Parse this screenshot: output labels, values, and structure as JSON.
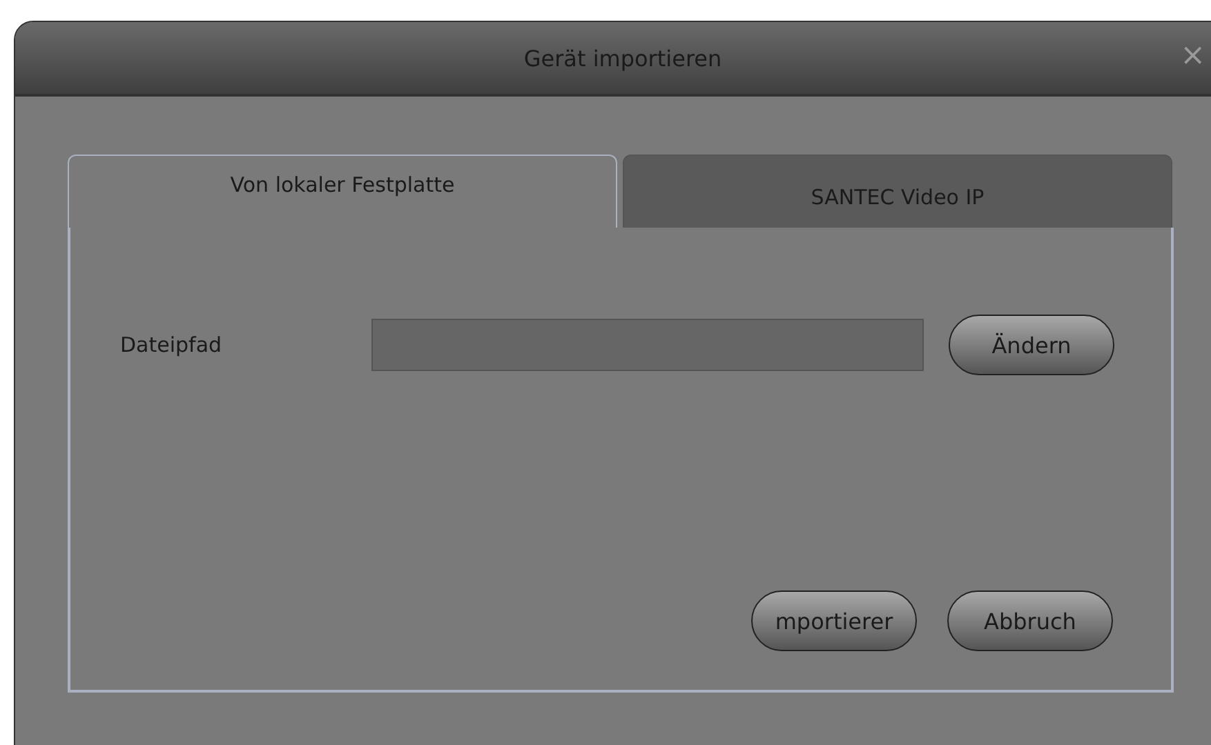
{
  "window": {
    "title": "Gerät importieren",
    "close": "×"
  },
  "tabs": [
    {
      "label": "Von lokaler Festplatte",
      "selected": true
    },
    {
      "label": "SANTEC Video IP",
      "selected": false
    }
  ],
  "file_path": {
    "label": "Dateipfad",
    "button": "Ändern"
  },
  "buttons": [
    "mportierer",
    "Abbruch"
  ]
}
